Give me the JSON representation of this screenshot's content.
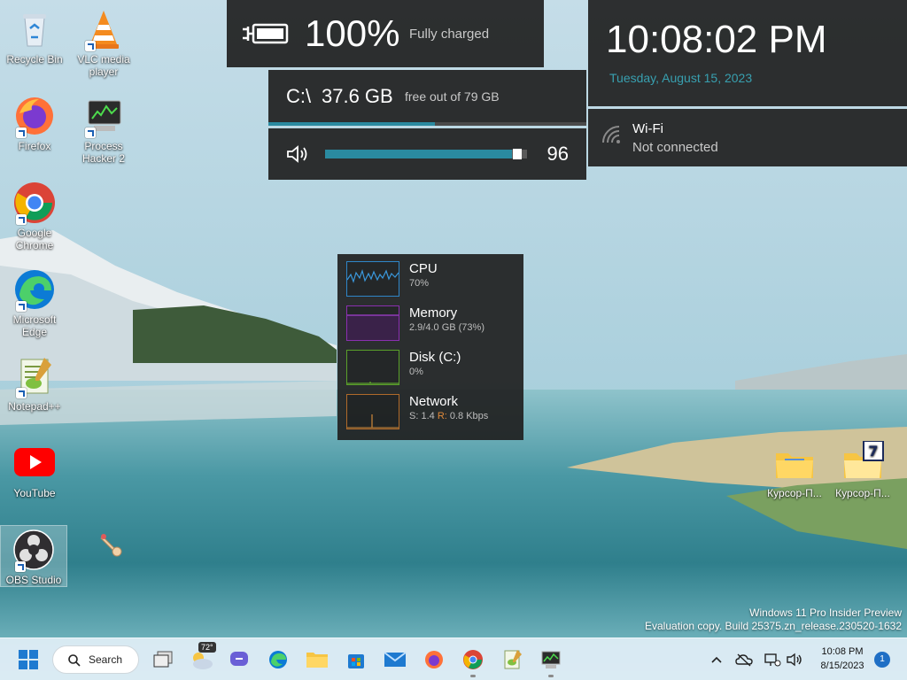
{
  "desktop_icons": [
    {
      "label": "Recycle Bin",
      "icon": "recycle-bin-icon"
    },
    {
      "label": "VLC media player",
      "icon": "vlc-icon"
    },
    {
      "label": "Firefox",
      "icon": "firefox-icon"
    },
    {
      "label": "Process Hacker 2",
      "icon": "process-hacker-icon"
    },
    {
      "label": "Google Chrome",
      "icon": "chrome-icon"
    },
    {
      "label": "Microsoft Edge",
      "icon": "edge-icon"
    },
    {
      "label": "Notepad++",
      "icon": "notepadpp-icon"
    },
    {
      "label": "YouTube",
      "icon": "youtube-icon"
    },
    {
      "label": "OBS Studio",
      "icon": "obs-icon"
    },
    {
      "label": "Курсор-П...",
      "icon": "folder-icon"
    },
    {
      "label": "Курсор-П...",
      "icon": "folder-icon"
    }
  ],
  "battery": {
    "percent": "100%",
    "status": "Fully charged",
    "icon": "battery-charging-icon"
  },
  "disk": {
    "drive": "C:\\",
    "free": "37.6 GB",
    "detail": "free out of 79 GB",
    "used_fraction": 0.524
  },
  "volume": {
    "value": "96",
    "level": 0.96,
    "icon": "speaker-icon"
  },
  "clock": {
    "time": "10:08:02 PM",
    "date": "Tuesday, August 15, 2023"
  },
  "wifi": {
    "name": "Wi-Fi",
    "status": "Not connected",
    "icon": "wifi-icon"
  },
  "performance": [
    {
      "title": "CPU",
      "value": "70%",
      "color": "#2f86c8"
    },
    {
      "title": "Memory",
      "value": "2.9/4.0 GB (73%)",
      "color": "#8a2fb0"
    },
    {
      "title": "Disk (C:)",
      "value": "0%",
      "color": "#5aa02a"
    },
    {
      "title": "Network",
      "value_s": "S: 1.4",
      "value_r_label": "R:",
      "value_r": "0.8 Kbps",
      "color": "#b06a2a"
    }
  ],
  "watermark": {
    "line1": "Windows 11 Pro Insider Preview",
    "line2": "Evaluation copy. Build 25375.zn_release.230520-1632"
  },
  "taskbar": {
    "search_label": "Search",
    "weather_temp": "72°",
    "apps": [
      "start",
      "search",
      "task-view",
      "widgets",
      "teams-chat",
      "edge",
      "file-explorer",
      "microsoft-store",
      "mail",
      "firefox",
      "chrome",
      "notepadpp",
      "process-hacker"
    ],
    "tray_time": "10:08 PM",
    "tray_date": "8/15/2023",
    "notification_count": "1"
  },
  "colors": {
    "accent": "#2a8aa0",
    "panel_bg": "#202020",
    "date_teal": "#38a0b0"
  }
}
